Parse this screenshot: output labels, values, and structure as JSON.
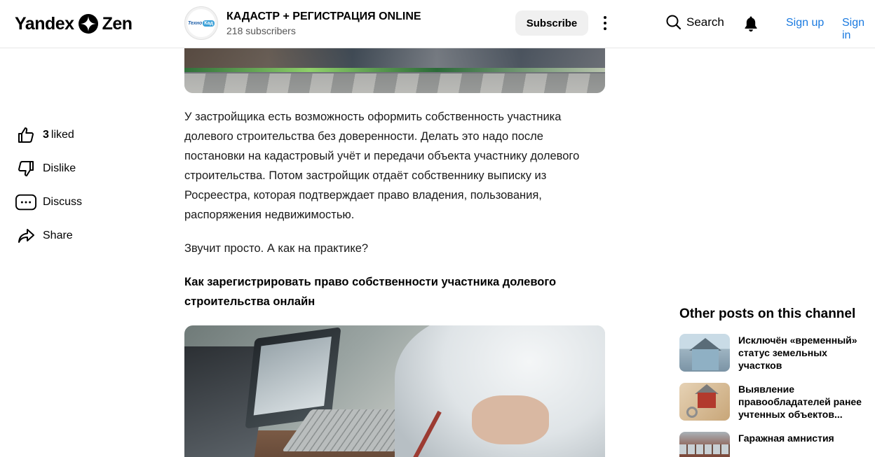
{
  "header": {
    "logo_left": "Yandex",
    "logo_right": "Zen",
    "channel_avatar_text": "Техно",
    "channel_avatar_badge": "Кад",
    "channel_name": "КАДАСТР + РЕГИСТРАЦИЯ ONLINE",
    "channel_subscribers": "218 subscribers",
    "subscribe_label": "Subscribe",
    "search_label": "Search",
    "signup_label": "Sign up",
    "signin_label": "Sign in"
  },
  "actions": {
    "like_count": "3",
    "like_label": "liked",
    "dislike_label": "Dislike",
    "discuss_label": "Discuss",
    "share_label": "Share"
  },
  "article": {
    "paragraph1": "У застройщика есть возможность оформить собственность участника долевого строительства без доверенности. Делать это надо после постановки на кадастровый учёт и передачи объекта участнику долевого строительства. Потом застройщик отдаёт собственнику выписку из Росреестра, которая подтверждает право владения, пользования, распоряжения недвижимостью.",
    "paragraph2": "Звучит просто. А как на практике?",
    "subheading": "Как зарегистрировать право собственности участника долевого строительства онлайн"
  },
  "sidebar": {
    "title": "Other posts on this channel",
    "posts": [
      {
        "title": "Исключён «временный» статус земельных участков"
      },
      {
        "title": "Выявление правообладателей ранее учтенных объектов..."
      },
      {
        "title": "Гаражная амнистия"
      }
    ]
  },
  "colors": {
    "link": "#1a7ae0",
    "subscribe_bg": "#f0f0f0"
  }
}
